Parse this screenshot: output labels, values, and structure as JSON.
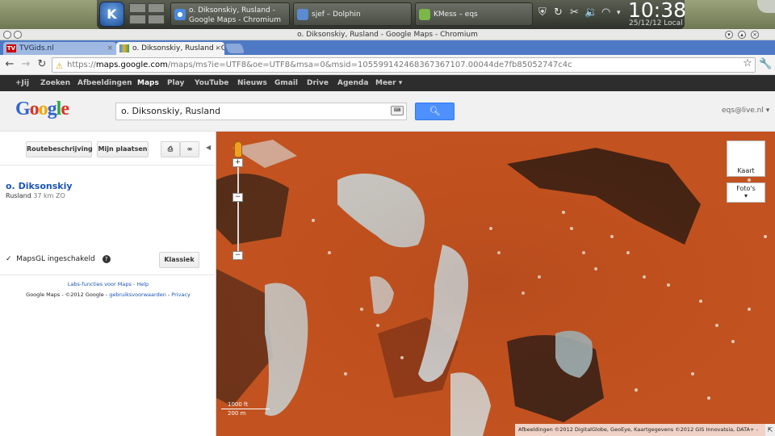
{
  "taskbar": {
    "tasks": [
      {
        "label": "o. Diksonskiy, Rusland - Google Maps - Chromium"
      },
      {
        "label": "sjef – Dolphin"
      },
      {
        "label": "KMess – eqs"
      }
    ],
    "clock": "10:38",
    "date": "25/12/12 Local"
  },
  "window": {
    "title": "o. Diksonskiy, Rusland - Google Maps - Chromium"
  },
  "tabs": [
    {
      "label": "TVGids.nl",
      "icon_text": "TV"
    },
    {
      "label": "o. Diksonskiy, Rusland - Go"
    }
  ],
  "address": {
    "scheme": "https://",
    "host": "maps.google.com",
    "path": "/maps/ms?ie=UTF8&oe=UTF8&msa=0&msid=105599142468367367107.00044de7fb85052747c4c"
  },
  "gbar": [
    "+Jij",
    "Zoeken",
    "Afbeeldingen",
    "Maps",
    "Play",
    "YouTube",
    "Nieuws",
    "Gmail",
    "Drive",
    "Agenda",
    "Meer ▾"
  ],
  "header": {
    "logo": "Google",
    "search_value": "o. Diksonskiy, Rusland",
    "account": "eqs@live.nl ▾"
  },
  "panel": {
    "route_label": "Routebeschrijving",
    "myplaces_label": "Mijn plaatsen",
    "place_title": "o. Diksonskiy",
    "place_country": "Rusland",
    "place_distance": "37 km ZO",
    "mapsgl_label": "MapsGL ingeschakeld",
    "klassiek_label": "Klassiek",
    "labs_text": "Labs-functies voor Maps",
    "help_text": "Help",
    "footer_text": "Google Maps - ©2012 Google -",
    "terms_text": "gebruiksvoorwaarden",
    "privacy_text": "Privacy"
  },
  "map": {
    "type_map": "Kaart",
    "type_photo": "Foto's",
    "scale_ft": "1000 ft",
    "scale_m": "200 m",
    "copyright": "Afbeeldingen ©2012 DigitalGlobe, GeoEye, Kaartgegevens ©2012 GIS Innovatsia, DATA+ -"
  },
  "colors": {
    "tabstrip": "#4e79c4",
    "gbar": "#2d2d2d",
    "search_button": "#4d90fe",
    "map_ground": "#c2521f",
    "link": "#1a55b5"
  }
}
